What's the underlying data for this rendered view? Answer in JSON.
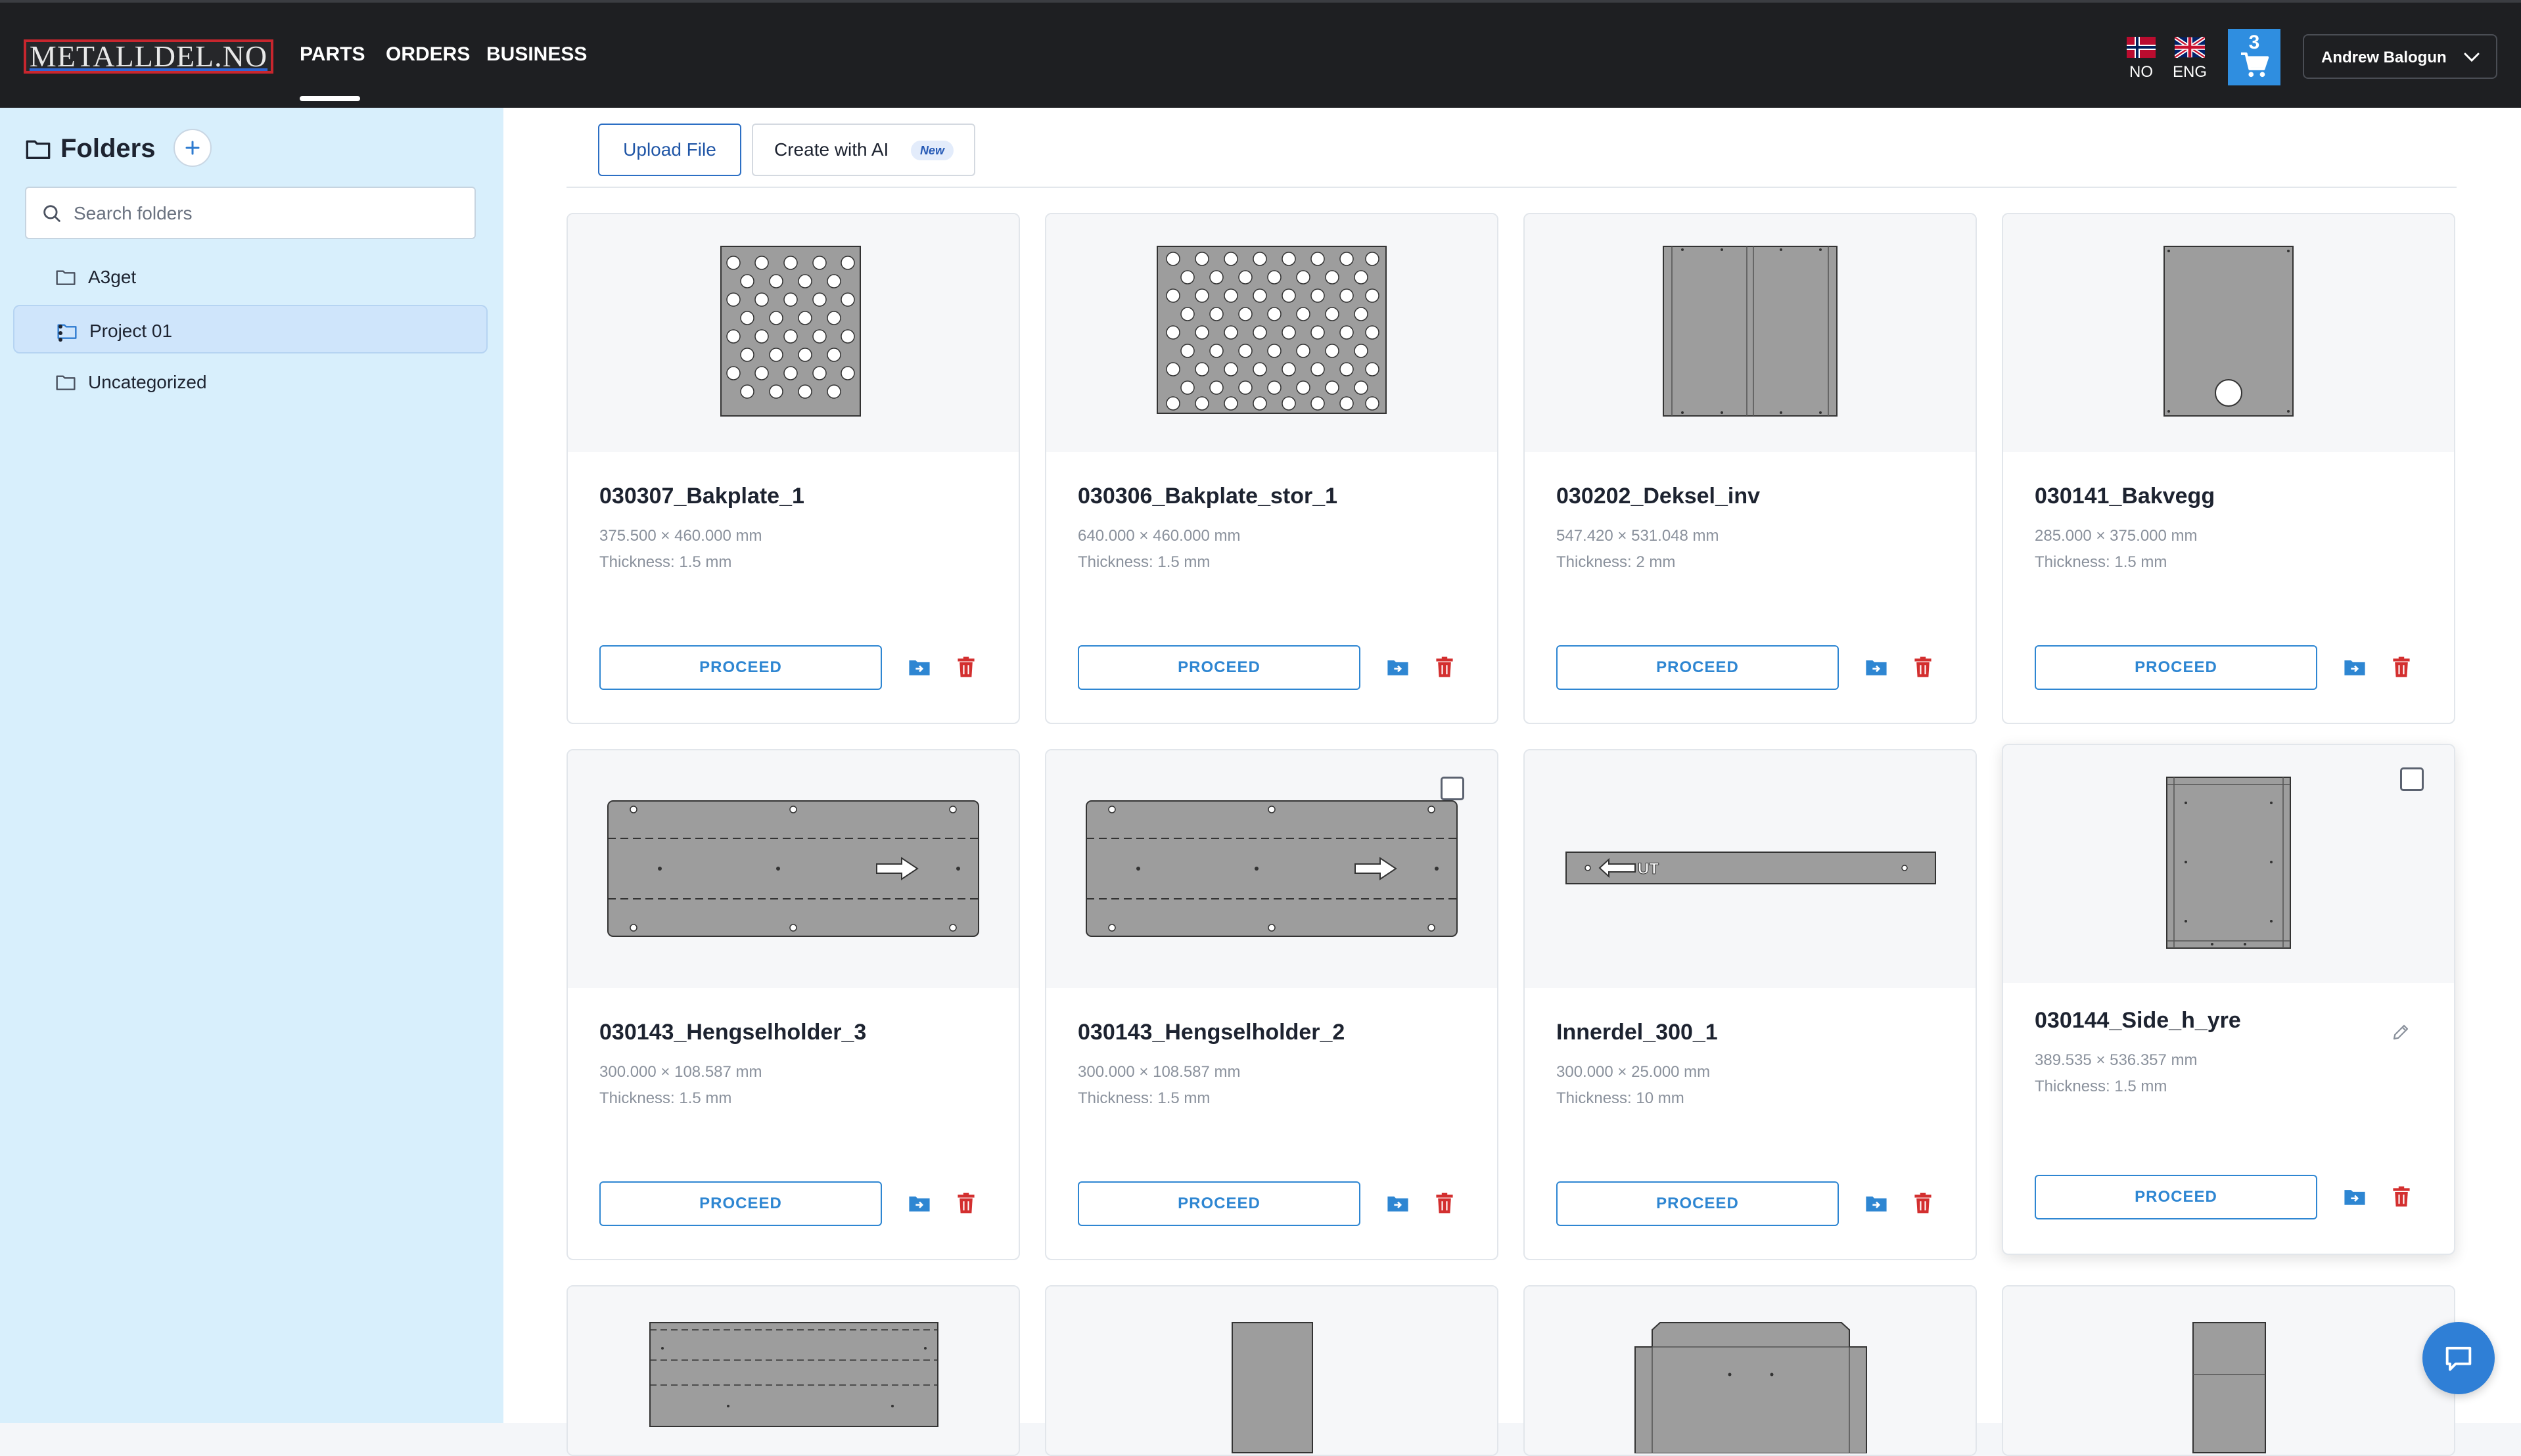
{
  "app": {
    "logo_text": "METALLDEL.NO"
  },
  "nav": {
    "items": [
      "PARTS",
      "ORDERS",
      "BUSINESS"
    ],
    "active": "PARTS"
  },
  "languages": [
    {
      "code": "NO",
      "icon": "norway-flag-icon"
    },
    {
      "code": "ENG",
      "icon": "uk-flag-icon"
    }
  ],
  "cart": {
    "count": "3",
    "icon": "cart-icon"
  },
  "user": {
    "name": "Andrew Balogun"
  },
  "sidebar": {
    "title": "Folders",
    "search_placeholder": "Search folders",
    "folders": [
      {
        "label": "A3get",
        "active": false
      },
      {
        "label": "Project 01",
        "active": true
      },
      {
        "label": "Uncategorized",
        "active": false
      }
    ]
  },
  "toolbar": {
    "upload_label": "Upload File",
    "create_ai_label": "Create with AI",
    "new_badge": "New"
  },
  "card_labels": {
    "proceed": "PROCEED"
  },
  "parts": [
    {
      "name": "030307_Bakplate_1",
      "dims": "375.500 × 460.000 mm",
      "thickness": "Thickness: 1.5 mm"
    },
    {
      "name": "030306_Bakplate_stor_1",
      "dims": "640.000 × 460.000 mm",
      "thickness": "Thickness: 1.5 mm"
    },
    {
      "name": "030202_Deksel_inv",
      "dims": "547.420 × 531.048 mm",
      "thickness": "Thickness: 2 mm"
    },
    {
      "name": "030141_Bakvegg",
      "dims": "285.000 × 375.000 mm",
      "thickness": "Thickness: 1.5 mm"
    },
    {
      "name": "030143_Hengselholder_3",
      "dims": "300.000 × 108.587 mm",
      "thickness": "Thickness: 1.5 mm"
    },
    {
      "name": "030143_Hengselholder_2",
      "dims": "300.000 × 108.587 mm",
      "thickness": "Thickness: 1.5 mm"
    },
    {
      "name": "Innerdel_300_1",
      "dims": "300.000 × 25.000 mm",
      "thickness": "Thickness: 10 mm",
      "drawing_label": "UT"
    },
    {
      "name": "030144_Side_h_yre",
      "dims": "389.535 × 536.357 mm",
      "thickness": "Thickness: 1.5 mm"
    }
  ],
  "colors": {
    "accent": "#2e86d2",
    "delete": "#d32f2f",
    "sidebar_bg": "#d8effc",
    "topbar_bg": "#1e1f22"
  }
}
